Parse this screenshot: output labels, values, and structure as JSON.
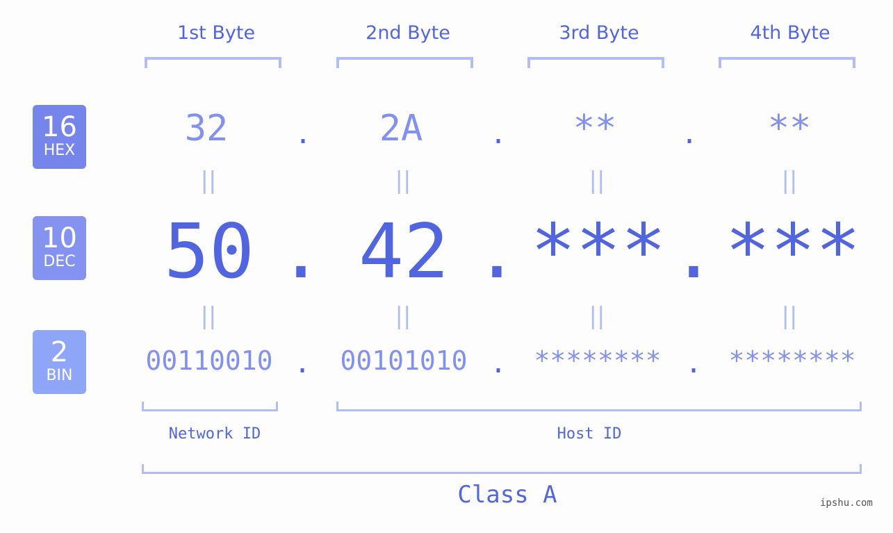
{
  "byte_headers": [
    "1st Byte",
    "2nd Byte",
    "3rd Byte",
    "4th Byte"
  ],
  "bases": [
    {
      "number": "16",
      "label": "HEX",
      "color": "#7685ec"
    },
    {
      "number": "10",
      "label": "DEC",
      "color": "#8493f0"
    },
    {
      "number": "2",
      "label": "BIN",
      "color": "#8fa5f7"
    }
  ],
  "hex": [
    "32",
    "2A",
    "**",
    "**"
  ],
  "dec": [
    "50",
    "42",
    "***",
    "***"
  ],
  "bin": [
    "00110010",
    "00101010",
    "********",
    "********"
  ],
  "separator": ".",
  "equals": "||",
  "network_id_label": "Network ID",
  "host_id_label": "Host ID",
  "class_label": "Class A",
  "watermark": "ipshu.com",
  "colors": {
    "accent": "#5265e0",
    "light": "#8391ee",
    "bracket": "#b2bdf5"
  }
}
